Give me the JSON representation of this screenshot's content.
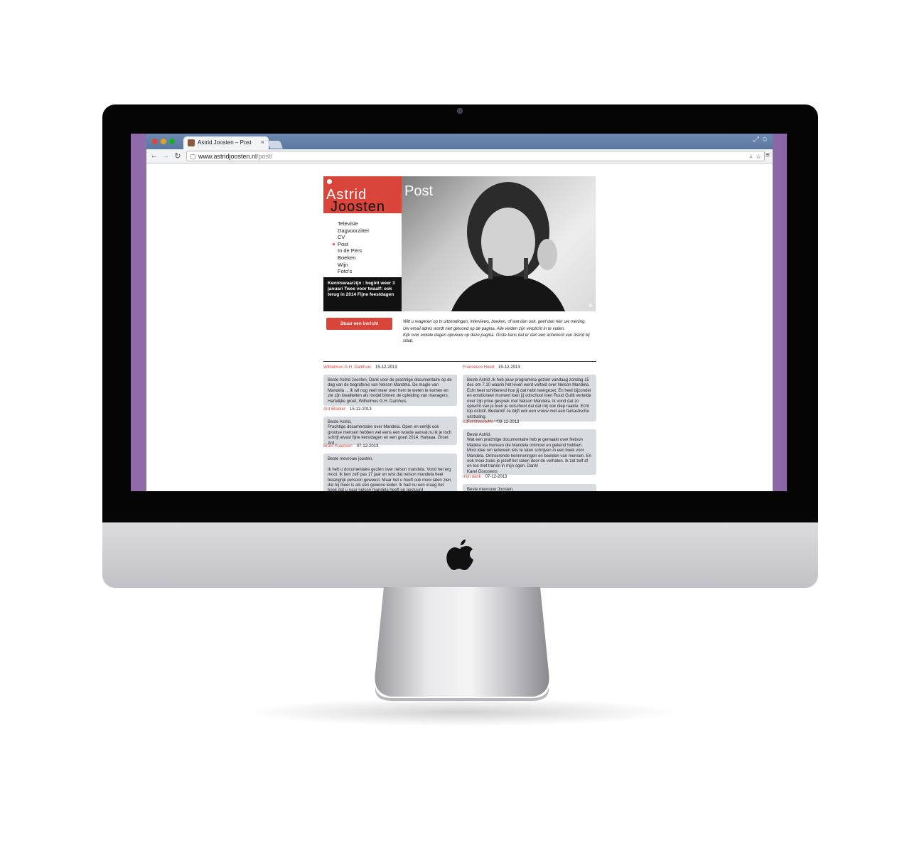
{
  "browser": {
    "tab_title": "Astrid Joosten – Post",
    "tab_close": "×",
    "url_host": "www.astridjoosten.nl",
    "url_path": "/post/",
    "back": "←",
    "forward": "→",
    "reload": "↻",
    "menu": "≡"
  },
  "site": {
    "logo_first": "Astrid",
    "logo_last": "Joosten",
    "nav": [
      {
        "label": "Televisie"
      },
      {
        "label": "Dagvoorzitter"
      },
      {
        "label": "CV"
      },
      {
        "label": "Post"
      },
      {
        "label": "In de Pers"
      },
      {
        "label": "Boeken"
      },
      {
        "label": "Wijn"
      },
      {
        "label": "Foto's"
      }
    ],
    "news": "Kenniswaarzijn : begint weer 3 januari Twee voor twaalf: ook terug in 2014 Fijne feestdagen",
    "hero_title": "Post",
    "hero_arrow": "»",
    "send_button": "Stuur een bericht",
    "intro_1": "Wilt u reageren op tv uitzendingen, interviews, boeken, of wat dan ook, geef dan hier uw mening.",
    "intro_2": "Uw email adres wordt niet getoond op de pagina. Alle velden zijn verplicht in te vullen.",
    "intro_3": "Kijk over enkele dagen opnieuw op deze pagina. Grote kans dat er dan een antwoord van Astrid bij staat."
  },
  "posts_left": [
    {
      "author": "Wilhelmus G.H. Damhuis",
      "date": "15-12-2013",
      "text": "Beste Astrid Joosten, Dank voor de prachtige documentaire op de dag van de begrafenis van Nelson Mandela. De magie van Mandela ... ik wil nog veel meer over hem te weten te komen en zie zijn kwaliteiten als model binnen de opleiding van managers. Hartelijke groet, Wilhelmus G.H. Damhuis"
    },
    {
      "author": "Ard Blokker",
      "date": "15-12-2013",
      "text": "Beste Astrid,\nPrachtige documentaire over Mandela. Open en eerlijk ook grootse mensen hebben wel eens een woede aanval.nu ik je toch schrijf alvast fijne kerstdagen en een goed 2014. Hahaaa. Groet Ard."
    },
    {
      "author": "Bram Klaassen",
      "date": "07-12-2013",
      "text": "Beste mevrouw joosten,\n\nIk heb u documentaire gezien over nelson mandela. Vond het erg mooi. Ik ben zelf pas 17 jaar en wist dat nelson mandela heel belangrijk persoon geweest. Maar het u hoeft ook mooi laten zien dat hij meer is als een gewone leider. Ik had nu een vraag het boek dat u naar nelson mandela heeft op gestuurd"
    }
  ],
  "posts_right": [
    {
      "author": "Francesco Hoed",
      "date": "15-12-2013",
      "text": "Beste Astrid .Ik heb jouw programma gezien vandaag zondag 15 dec om 7.10 waarin het leven werd verteld over Nelson Mandela. Echt heel schitterend hoe jij dat hebt neergezet. En heel bijzonder en emotioneel moment toen jij volschoot toen Ruud Gullit vertelde over zijn prive gesprek met Nelson Mandela. Ik vond dat zo oprecht van je toen je volschoot dat dat mij ook diep raakte. Echt top Astrid!. Bedankt! Je blijft ook een vrouw met een fantastische uitstraling.\nFrancesco Hoed"
    },
    {
      "author": "Karel Goossens",
      "date": "09-12-2013",
      "text": "Beste Astrid,\nWat een prachtige documentaire heb je gemaakt over Nelson Madela via mensen die Mandela ontmoet en gekend hebben. Mooi idee om iedereen iets te laten schrijven in een boek voor Mandela. Ontroerende herinneringen en beelden van mensen. En ook mooi zoals je jezelf liet raken door de verhalen. Ik zat zelf af en toe met tranen in mijn ogen. Dank!\nKarel Goossens"
    },
    {
      "author": "mijn dank",
      "date": "07-12-2013",
      "text": "Beste mevrouw Joosten,"
    }
  ]
}
